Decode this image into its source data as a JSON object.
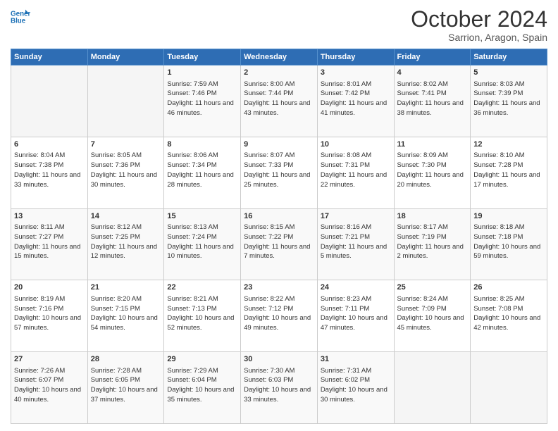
{
  "header": {
    "title": "October 2024",
    "subtitle": "Sarrion, Aragon, Spain",
    "logo_line1": "General",
    "logo_line2": "Blue"
  },
  "calendar": {
    "headers": [
      "Sunday",
      "Monday",
      "Tuesday",
      "Wednesday",
      "Thursday",
      "Friday",
      "Saturday"
    ],
    "rows": [
      [
        {
          "day": "",
          "info": ""
        },
        {
          "day": "",
          "info": ""
        },
        {
          "day": "1",
          "info": "Sunrise: 7:59 AM\nSunset: 7:46 PM\nDaylight: 11 hours\nand 46 minutes."
        },
        {
          "day": "2",
          "info": "Sunrise: 8:00 AM\nSunset: 7:44 PM\nDaylight: 11 hours\nand 43 minutes."
        },
        {
          "day": "3",
          "info": "Sunrise: 8:01 AM\nSunset: 7:42 PM\nDaylight: 11 hours\nand 41 minutes."
        },
        {
          "day": "4",
          "info": "Sunrise: 8:02 AM\nSunset: 7:41 PM\nDaylight: 11 hours\nand 38 minutes."
        },
        {
          "day": "5",
          "info": "Sunrise: 8:03 AM\nSunset: 7:39 PM\nDaylight: 11 hours\nand 36 minutes."
        }
      ],
      [
        {
          "day": "6",
          "info": "Sunrise: 8:04 AM\nSunset: 7:38 PM\nDaylight: 11 hours\nand 33 minutes."
        },
        {
          "day": "7",
          "info": "Sunrise: 8:05 AM\nSunset: 7:36 PM\nDaylight: 11 hours\nand 30 minutes."
        },
        {
          "day": "8",
          "info": "Sunrise: 8:06 AM\nSunset: 7:34 PM\nDaylight: 11 hours\nand 28 minutes."
        },
        {
          "day": "9",
          "info": "Sunrise: 8:07 AM\nSunset: 7:33 PM\nDaylight: 11 hours\nand 25 minutes."
        },
        {
          "day": "10",
          "info": "Sunrise: 8:08 AM\nSunset: 7:31 PM\nDaylight: 11 hours\nand 22 minutes."
        },
        {
          "day": "11",
          "info": "Sunrise: 8:09 AM\nSunset: 7:30 PM\nDaylight: 11 hours\nand 20 minutes."
        },
        {
          "day": "12",
          "info": "Sunrise: 8:10 AM\nSunset: 7:28 PM\nDaylight: 11 hours\nand 17 minutes."
        }
      ],
      [
        {
          "day": "13",
          "info": "Sunrise: 8:11 AM\nSunset: 7:27 PM\nDaylight: 11 hours\nand 15 minutes."
        },
        {
          "day": "14",
          "info": "Sunrise: 8:12 AM\nSunset: 7:25 PM\nDaylight: 11 hours\nand 12 minutes."
        },
        {
          "day": "15",
          "info": "Sunrise: 8:13 AM\nSunset: 7:24 PM\nDaylight: 11 hours\nand 10 minutes."
        },
        {
          "day": "16",
          "info": "Sunrise: 8:15 AM\nSunset: 7:22 PM\nDaylight: 11 hours\nand 7 minutes."
        },
        {
          "day": "17",
          "info": "Sunrise: 8:16 AM\nSunset: 7:21 PM\nDaylight: 11 hours\nand 5 minutes."
        },
        {
          "day": "18",
          "info": "Sunrise: 8:17 AM\nSunset: 7:19 PM\nDaylight: 11 hours\nand 2 minutes."
        },
        {
          "day": "19",
          "info": "Sunrise: 8:18 AM\nSunset: 7:18 PM\nDaylight: 10 hours\nand 59 minutes."
        }
      ],
      [
        {
          "day": "20",
          "info": "Sunrise: 8:19 AM\nSunset: 7:16 PM\nDaylight: 10 hours\nand 57 minutes."
        },
        {
          "day": "21",
          "info": "Sunrise: 8:20 AM\nSunset: 7:15 PM\nDaylight: 10 hours\nand 54 minutes."
        },
        {
          "day": "22",
          "info": "Sunrise: 8:21 AM\nSunset: 7:13 PM\nDaylight: 10 hours\nand 52 minutes."
        },
        {
          "day": "23",
          "info": "Sunrise: 8:22 AM\nSunset: 7:12 PM\nDaylight: 10 hours\nand 49 minutes."
        },
        {
          "day": "24",
          "info": "Sunrise: 8:23 AM\nSunset: 7:11 PM\nDaylight: 10 hours\nand 47 minutes."
        },
        {
          "day": "25",
          "info": "Sunrise: 8:24 AM\nSunset: 7:09 PM\nDaylight: 10 hours\nand 45 minutes."
        },
        {
          "day": "26",
          "info": "Sunrise: 8:25 AM\nSunset: 7:08 PM\nDaylight: 10 hours\nand 42 minutes."
        }
      ],
      [
        {
          "day": "27",
          "info": "Sunrise: 7:26 AM\nSunset: 6:07 PM\nDaylight: 10 hours\nand 40 minutes."
        },
        {
          "day": "28",
          "info": "Sunrise: 7:28 AM\nSunset: 6:05 PM\nDaylight: 10 hours\nand 37 minutes."
        },
        {
          "day": "29",
          "info": "Sunrise: 7:29 AM\nSunset: 6:04 PM\nDaylight: 10 hours\nand 35 minutes."
        },
        {
          "day": "30",
          "info": "Sunrise: 7:30 AM\nSunset: 6:03 PM\nDaylight: 10 hours\nand 33 minutes."
        },
        {
          "day": "31",
          "info": "Sunrise: 7:31 AM\nSunset: 6:02 PM\nDaylight: 10 hours\nand 30 minutes."
        },
        {
          "day": "",
          "info": ""
        },
        {
          "day": "",
          "info": ""
        }
      ]
    ]
  }
}
